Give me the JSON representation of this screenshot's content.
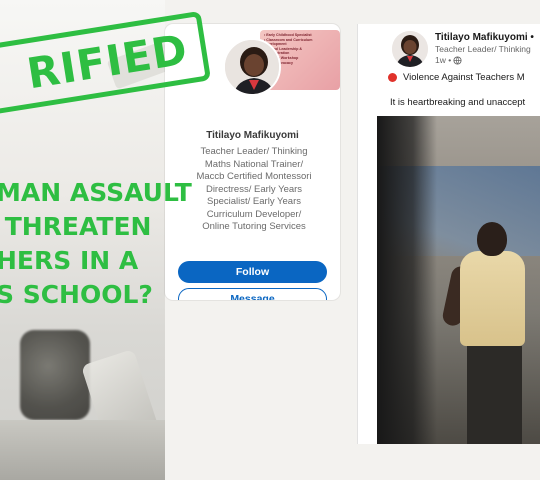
{
  "overlay": {
    "stamp_text": "RIFIED",
    "headline": "MAN ASSAULT\n THREATEN\nHERS IN A\nS SCHOOL?",
    "accent_color": "#2ebe42"
  },
  "profile": {
    "name": "Titilayo Mafikuyomi",
    "headline": "Teacher Leader/ Thinking\nMaths National Trainer/\nMaccb Certified Montessori\nDirectress/ Early Years\nSpecialist/ Early Years\nCurriculum Developer/\nOnline Tutoring Services",
    "banner_lines": [
      "• Early Childhood Specialist",
      "• Classroom and Curriculum",
      "Development",
      "• School Leadership &",
      "Administration",
      "• Teacher Workshop",
      "EDD & Advocacy"
    ],
    "follow_label": "Follow",
    "message_label": "Message",
    "brand_color": "#0a66c2"
  },
  "post": {
    "author": "Titilayo Mafikuyomi •",
    "author_headline": "Teacher Leader/ Thinking",
    "time": "1w •",
    "title": "Violence Against Teachers M",
    "body": "It is heartbreaking and unaccept"
  },
  "icons": {
    "globe": "globe-icon",
    "status_dot": "red-dot-icon"
  }
}
